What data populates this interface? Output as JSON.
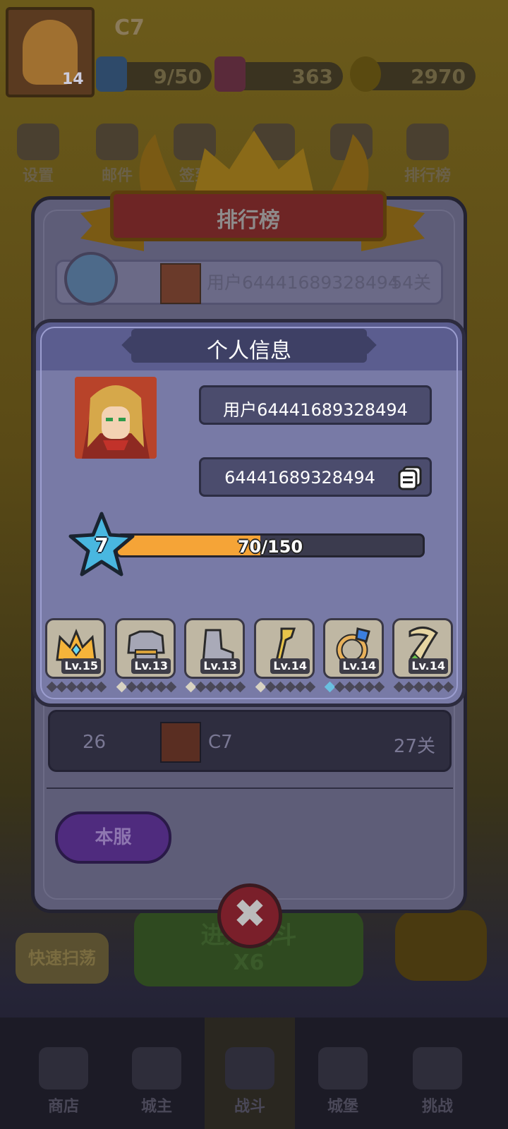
{
  "player": {
    "name": "C7",
    "level_badge": "14"
  },
  "resources": [
    {
      "name": "stamina",
      "value": "9/50",
      "color": "#3a77c7"
    },
    {
      "name": "gems",
      "value": "363",
      "color": "#c03a6a"
    },
    {
      "name": "gold",
      "value": "2970",
      "color": "#e0b020"
    }
  ],
  "top_menu": [
    {
      "id": "settings",
      "label": "设置"
    },
    {
      "id": "mail",
      "label": "邮件"
    },
    {
      "id": "signin",
      "label": "签到"
    },
    {
      "id": "event",
      "label": ""
    },
    {
      "id": "gift",
      "label": ""
    },
    {
      "id": "leaderboard",
      "label": "排行榜"
    }
  ],
  "leaderboard": {
    "title": "排行榜",
    "top_row": {
      "name": "用户64441689328494",
      "level": "54关"
    },
    "my_row": {
      "rank": "26",
      "name": "C7",
      "level": "27关"
    },
    "server_button": "本服"
  },
  "personal_info": {
    "title": "个人信息",
    "username": "用户64441689328494",
    "user_id": "64441689328494",
    "level": "7",
    "xp_text": "70/150",
    "xp_fraction": 0.4667,
    "equipment": [
      {
        "name": "crown",
        "level": "Lv.15",
        "gem_colors": [
          "#4a4858",
          "#4a4858",
          "#4a4858",
          "#4a4858",
          "#4a4858",
          "#4a4858"
        ]
      },
      {
        "name": "armor",
        "level": "Lv.13",
        "gem_colors": [
          "#d8d2c2",
          "#4a4858",
          "#4a4858",
          "#4a4858",
          "#4a4858",
          "#4a4858"
        ]
      },
      {
        "name": "boots",
        "level": "Lv.13",
        "gem_colors": [
          "#d8d2c2",
          "#4a4858",
          "#4a4858",
          "#4a4858",
          "#4a4858",
          "#4a4858"
        ]
      },
      {
        "name": "staff",
        "level": "Lv.14",
        "gem_colors": [
          "#d8d2c2",
          "#4a4858",
          "#4a4858",
          "#4a4858",
          "#4a4858",
          "#4a4858"
        ]
      },
      {
        "name": "ring",
        "level": "Lv.14",
        "gem_colors": [
          "#6ac0e0",
          "#4a4858",
          "#4a4858",
          "#4a4858",
          "#4a4858",
          "#4a4858"
        ]
      },
      {
        "name": "necklace",
        "level": "Lv.14",
        "gem_colors": [
          "#4a4858",
          "#4a4858",
          "#4a4858",
          "#4a4858",
          "#4a4858",
          "#4a4858"
        ]
      }
    ]
  },
  "battle": {
    "label": "进入战斗",
    "cost": "X6"
  },
  "quick_sweep": "快速扫荡",
  "bottom_nav": [
    {
      "id": "shop",
      "label": "商店"
    },
    {
      "id": "lord",
      "label": "城主"
    },
    {
      "id": "battle",
      "label": "战斗"
    },
    {
      "id": "castle",
      "label": "城堡"
    },
    {
      "id": "challenge",
      "label": "挑战"
    }
  ],
  "colors": {
    "xp_fill": "#f5a437",
    "modal_bg": "#787aa6",
    "header_bg": "#3e4065"
  }
}
